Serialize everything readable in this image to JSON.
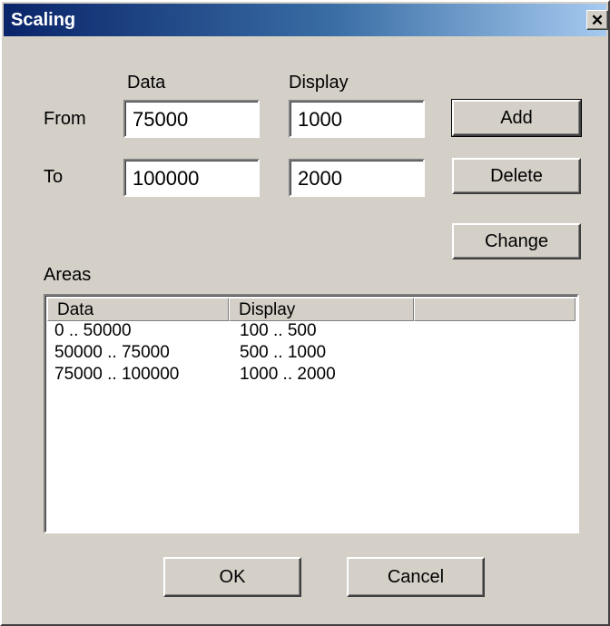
{
  "window": {
    "title": "Scaling",
    "close_symbol": "✕"
  },
  "form": {
    "column_data_label": "Data",
    "column_display_label": "Display",
    "from_label": "From",
    "to_label": "To",
    "from_data": "75000",
    "from_display": "1000",
    "to_data": "100000",
    "to_display": "2000"
  },
  "buttons": {
    "add": "Add",
    "delete": "Delete",
    "change": "Change",
    "ok": "OK",
    "cancel": "Cancel"
  },
  "areas": {
    "label": "Areas",
    "columns": [
      "Data",
      "Display",
      ""
    ],
    "rows": [
      {
        "data": "0 .. 50000",
        "display": "100 .. 500"
      },
      {
        "data": "50000 .. 75000",
        "display": "500 .. 1000"
      },
      {
        "data": "75000 .. 100000",
        "display": "1000 .. 2000"
      }
    ]
  }
}
